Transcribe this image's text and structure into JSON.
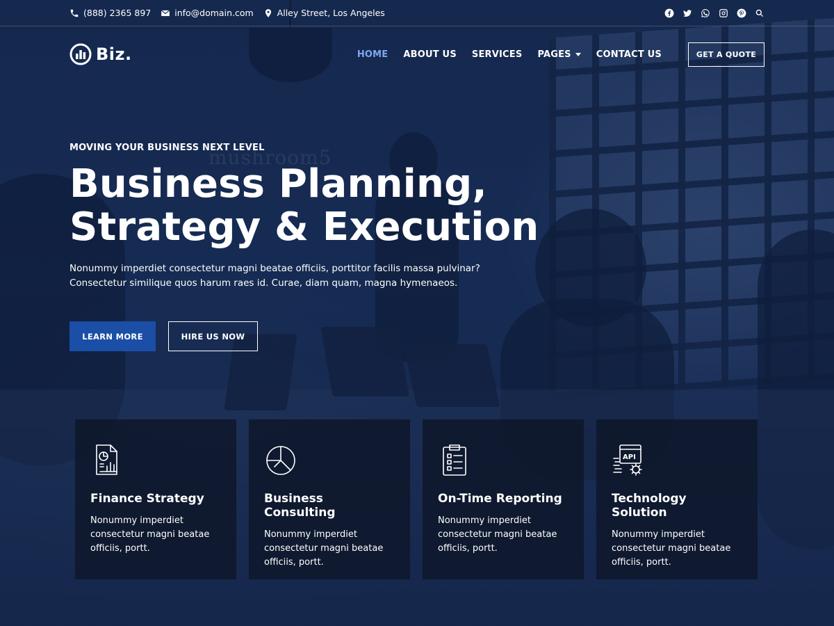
{
  "topbar": {
    "phone": "(888) 2365 897",
    "email": "info@domain.com",
    "address": "Alley Street, Los Angeles",
    "socials": [
      "facebook-icon",
      "twitter-icon",
      "whatsapp-icon",
      "instagram-icon",
      "pinterest-icon",
      "search-icon"
    ]
  },
  "nav": {
    "logo_text": "Biz.",
    "items": [
      {
        "label": "HOME",
        "active": true
      },
      {
        "label": "ABOUT US"
      },
      {
        "label": "SERVICES"
      },
      {
        "label": "PAGES",
        "has_dropdown": true
      },
      {
        "label": "CONTACT US"
      }
    ],
    "cta_label": "GET A QUOTE"
  },
  "hero": {
    "eyebrow": "MOVING YOUR BUSINESS NEXT LEVEL",
    "headline_line1": "Business Planning,",
    "headline_line2": "Strategy & Execution",
    "lead_line1": "Nonummy imperdiet consectetur magni beatae officiis, porttitor facilis massa pulvinar?",
    "lead_line2": "Consectetur similique quos harum raes id. Curae, diam quam, magna hymenaeos.",
    "primary_button": "LEARN MORE",
    "secondary_button": "HIRE US NOW",
    "background_text": "mushroom5"
  },
  "cards": [
    {
      "icon": "finance-report-icon",
      "title": "Finance Strategy",
      "text": "Nonummy imperdiet consectetur magni beatae officiis, portt."
    },
    {
      "icon": "pie-chart-icon",
      "title": "Business Consulting",
      "text": "Nonummy imperdiet consectetur magni beatae officiis, portt."
    },
    {
      "icon": "clipboard-checklist-icon",
      "title": "On-Time Reporting",
      "text": "Nonummy imperdiet consectetur magni beatae officiis, portt."
    },
    {
      "icon": "api-gear-icon",
      "title": "Technology Solution",
      "text": "Nonummy imperdiet consectetur magni beatae officiis, portt."
    }
  ],
  "colors": {
    "accent": "#1b4ea6",
    "nav_active": "#7ea8ef",
    "overlay": "#14284b"
  }
}
